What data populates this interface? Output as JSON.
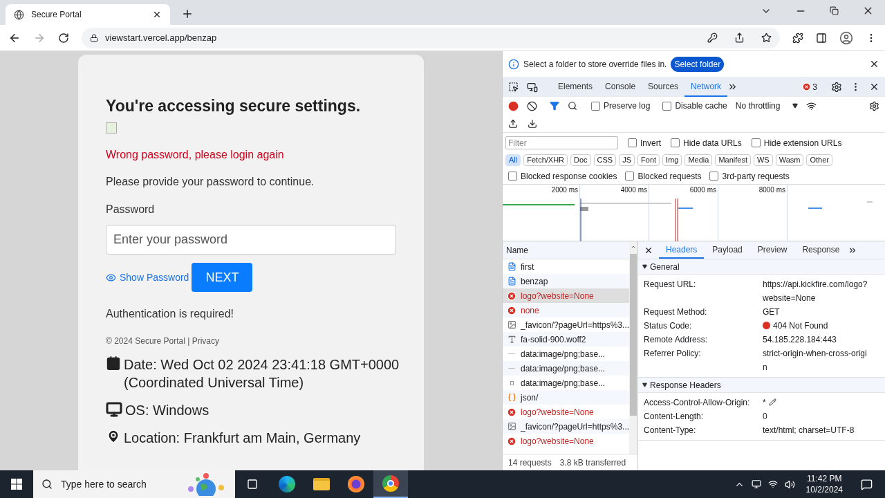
{
  "browser": {
    "tab_title": "Secure Portal",
    "url": "viewstart.vercel.app/benzap"
  },
  "page": {
    "heading": "You're accessing secure settings.",
    "error": "Wrong password, please login again",
    "instruction": "Please provide your password to continue.",
    "password_label": "Password",
    "password_placeholder": "Enter your password",
    "show_password": "Show Password",
    "next": "NEXT",
    "auth_note": "Authentication is required!",
    "footer": "© 2024 Secure Portal | Privacy",
    "info": [
      {
        "kind": "date",
        "text": "Date: Wed Oct 02 2024 23:41:18 GMT+0000 (Coordinated Universal Time)"
      },
      {
        "kind": "os",
        "text": "OS: Windows"
      },
      {
        "kind": "location",
        "text": "Location: Frankfurt am Main, Germany"
      }
    ]
  },
  "devtools": {
    "infobar": {
      "text": "Select a folder to store override files in.",
      "button": "Select folder"
    },
    "tabs": [
      {
        "label": "Elements",
        "selected": false
      },
      {
        "label": "Console",
        "selected": false
      },
      {
        "label": "Sources",
        "selected": false
      },
      {
        "label": "Network",
        "selected": true
      }
    ],
    "error_count": "3",
    "toolbar": {
      "preserve_log": {
        "label": "Preserve log",
        "checked": false
      },
      "disable_cache": {
        "label": "Disable cache",
        "checked": false
      },
      "throttling": "No throttling"
    },
    "filter": {
      "placeholder": "Filter",
      "options": [
        {
          "label": "Invert",
          "checked": false
        },
        {
          "label": "Hide data URLs",
          "checked": false
        },
        {
          "label": "Hide extension URLs",
          "checked": false
        }
      ]
    },
    "types": [
      {
        "label": "All",
        "selected": true
      },
      {
        "label": "Fetch/XHR",
        "selected": false
      },
      {
        "label": "Doc",
        "selected": false
      },
      {
        "label": "CSS",
        "selected": false
      },
      {
        "label": "JS",
        "selected": false
      },
      {
        "label": "Font",
        "selected": false
      },
      {
        "label": "Img",
        "selected": false
      },
      {
        "label": "Media",
        "selected": false
      },
      {
        "label": "Manifest",
        "selected": false
      },
      {
        "label": "WS",
        "selected": false
      },
      {
        "label": "Wasm",
        "selected": false
      },
      {
        "label": "Other",
        "selected": false
      }
    ],
    "blocked": [
      {
        "label": "Blocked response cookies",
        "checked": false
      },
      {
        "label": "Blocked requests",
        "checked": false
      },
      {
        "label": "3rd-party requests",
        "checked": false
      }
    ],
    "timeline_ticks": [
      "2000 ms",
      "4000 ms",
      "6000 ms",
      "8000 ms"
    ],
    "list_header": "Name",
    "requests": [
      {
        "name": "first",
        "kind": "doc",
        "selected": false
      },
      {
        "name": "benzap",
        "kind": "doc",
        "selected": false
      },
      {
        "name": "logo?website=None",
        "kind": "error",
        "selected": true
      },
      {
        "name": "none",
        "kind": "error",
        "selected": false
      },
      {
        "name": "_favicon/?pageUrl=https%3...",
        "kind": "image",
        "selected": false
      },
      {
        "name": "fa-solid-900.woff2",
        "kind": "font",
        "selected": false
      },
      {
        "name": "data:image/png;base...",
        "kind": "data",
        "selected": false
      },
      {
        "name": "data:image/png;base...",
        "kind": "data",
        "selected": false
      },
      {
        "name": "data:image/png;base...",
        "kind": "small",
        "selected": false
      },
      {
        "name": "json/",
        "kind": "json",
        "selected": false
      },
      {
        "name": "logo?website=None",
        "kind": "error",
        "selected": false
      },
      {
        "name": "_favicon/?pageUrl=https%3...",
        "kind": "image",
        "selected": false
      },
      {
        "name": "logo?website=None",
        "kind": "error",
        "selected": false
      }
    ],
    "summary": [
      "14 requests",
      "3.8 kB transferred"
    ],
    "detail_tabs": [
      {
        "label": "Headers",
        "selected": true
      },
      {
        "label": "Payload",
        "selected": false
      },
      {
        "label": "Preview",
        "selected": false
      },
      {
        "label": "Response",
        "selected": false
      }
    ],
    "sections": [
      {
        "title": "General",
        "expanded": true,
        "rows": [
          {
            "key": "Request URL:",
            "value": "https://api.kickfire.com/logo?website=None",
            "kind": "text"
          },
          {
            "key": "Request Method:",
            "value": "GET",
            "kind": "text"
          },
          {
            "key": "Status Code:",
            "value": "404 Not Found",
            "kind": "status"
          },
          {
            "key": "Remote Address:",
            "value": "54.185.228.184:443",
            "kind": "text"
          },
          {
            "key": "Referrer Policy:",
            "value": "strict-origin-when-cross-origin",
            "kind": "text"
          }
        ]
      },
      {
        "title": "Response Headers",
        "expanded": true,
        "rows": [
          {
            "key": "Access-Control-Allow-Origin:",
            "value": "*",
            "kind": "editable"
          },
          {
            "key": "Content-Length:",
            "value": "0",
            "kind": "text"
          },
          {
            "key": "Content-Type:",
            "value": "text/html; charset=UTF-8",
            "kind": "text"
          }
        ]
      }
    ]
  },
  "taskbar": {
    "search_placeholder": "Type here to search",
    "time": "11:42 PM",
    "date": "10/2/2024"
  }
}
